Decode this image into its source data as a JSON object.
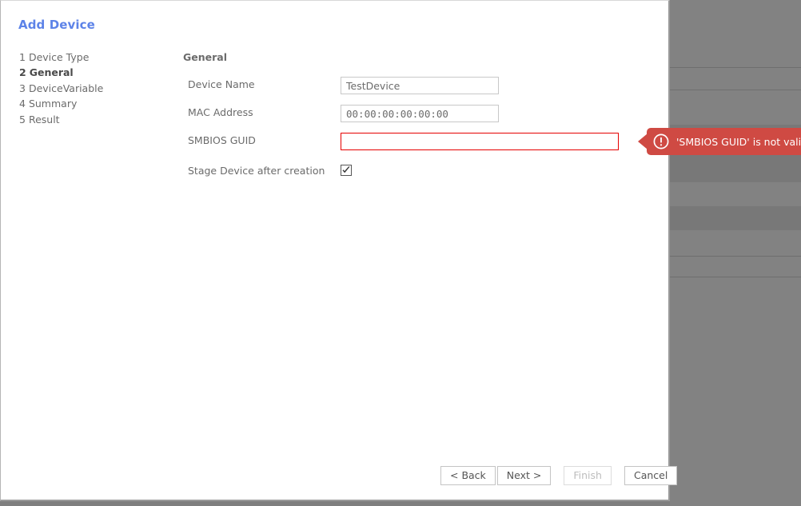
{
  "dialog": {
    "title": "Add Device",
    "section_heading": "General"
  },
  "steps": [
    {
      "num": "1",
      "label": "Device Type",
      "current": false
    },
    {
      "num": "2",
      "label": "General",
      "current": true
    },
    {
      "num": "3",
      "label": "DeviceVariable",
      "current": false
    },
    {
      "num": "4",
      "label": "Summary",
      "current": false
    },
    {
      "num": "5",
      "label": "Result",
      "current": false
    }
  ],
  "fields": {
    "device_name": {
      "label": "Device Name",
      "value": "TestDevice",
      "placeholder": ""
    },
    "mac_address": {
      "label": "MAC Address",
      "value": "00:00:00:00:00:00",
      "placeholder": ""
    },
    "smbios_guid": {
      "label": "SMBIOS GUID",
      "value": "",
      "placeholder": ""
    },
    "stage_device": {
      "label": "Stage Device after creation",
      "checked": true
    }
  },
  "error_tooltip": {
    "message": "'SMBIOS GUID' is not valid.",
    "icon": "exclamation-circle-icon",
    "color": "#cf4a43"
  },
  "buttons": {
    "back": "< Back",
    "next": "Next >",
    "finish": "Finish",
    "cancel": "Cancel"
  },
  "colors": {
    "title": "#5d83e8",
    "error": "#e60000",
    "tooltip": "#cf4a43",
    "backdrop": "#7f7f7f"
  }
}
